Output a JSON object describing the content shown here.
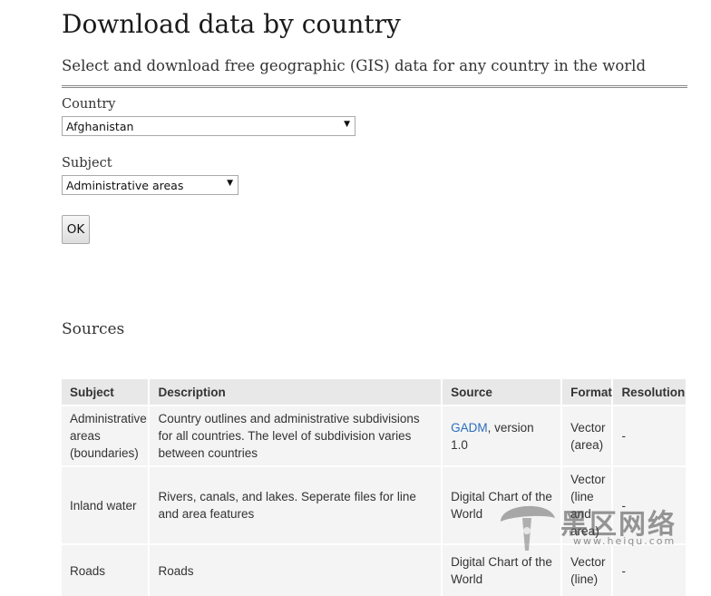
{
  "header": {
    "title": "Download data by country",
    "subtitle": "Select and download free geographic (GIS) data for any country in the world"
  },
  "form": {
    "country_label": "Country",
    "country_selected": "Afghanistan",
    "subject_label": "Subject",
    "subject_selected": "Administrative areas",
    "ok_label": "OK"
  },
  "sources": {
    "heading": "Sources",
    "columns": [
      "Subject",
      "Description",
      "Source",
      "Format",
      "Resolution"
    ],
    "rows": [
      {
        "subject": "Administrative areas (boundaries)",
        "description": "Country outlines and administrative subdivisions for all countries. The level of subdivision varies between countries",
        "source_link": "GADM",
        "source_rest": ", version 1.0",
        "format": "Vector (area)",
        "resolution": "-"
      },
      {
        "subject": "Inland water",
        "description": "Rivers, canals, and lakes. Seperate files for line and area features",
        "source": "Digital Chart of the World",
        "format": "Vector (line and area)",
        "resolution": "-"
      },
      {
        "subject": "Roads",
        "description": "Roads",
        "source": "Digital Chart of the World",
        "format": "Vector (line)",
        "resolution": "-"
      }
    ]
  },
  "watermark": {
    "text": "黑区网络",
    "url": "www.heiqu.com"
  },
  "icons": {
    "select_arrow": "dropdown-arrow-icon",
    "watermark_logo": "mushroom-logo-icon"
  },
  "colors": {
    "link": "#2a6ebb",
    "table_header_bg": "#e8e8e8",
    "table_cell_bg": "#f4f4f4"
  }
}
